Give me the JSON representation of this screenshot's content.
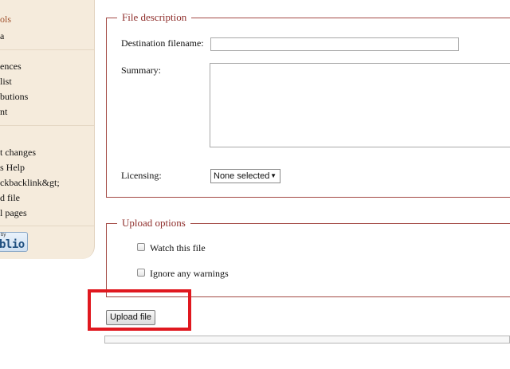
{
  "sidebar": {
    "heading": "ols",
    "items": [
      {
        "label": "a"
      },
      {
        "label": "ences"
      },
      {
        "label": "list"
      },
      {
        "label": "butions"
      },
      {
        "label": "nt"
      },
      {
        "label": "t changes"
      },
      {
        "label": "s Help"
      },
      {
        "label": "ckbacklink&gt;"
      },
      {
        "label": "d file"
      },
      {
        "label": "l pages"
      }
    ],
    "powered_by": {
      "prefix": "by",
      "brand": "blio"
    }
  },
  "file_description": {
    "legend": "File description",
    "destination_label": "Destination filename:",
    "destination_value": "",
    "summary_label": "Summary:",
    "summary_value": "",
    "licensing_label": "Licensing:",
    "licensing_selected": "None selected"
  },
  "upload_options": {
    "legend": "Upload options",
    "watch_label": "Watch this file",
    "ignore_label": "Ignore any warnings"
  },
  "upload_button_label": "Upload file",
  "colors": {
    "fieldset_border": "#a34a45",
    "legend_text": "#8f2f2c",
    "sidebar_bg": "#f5ebdc",
    "highlight": "#e0181f"
  }
}
